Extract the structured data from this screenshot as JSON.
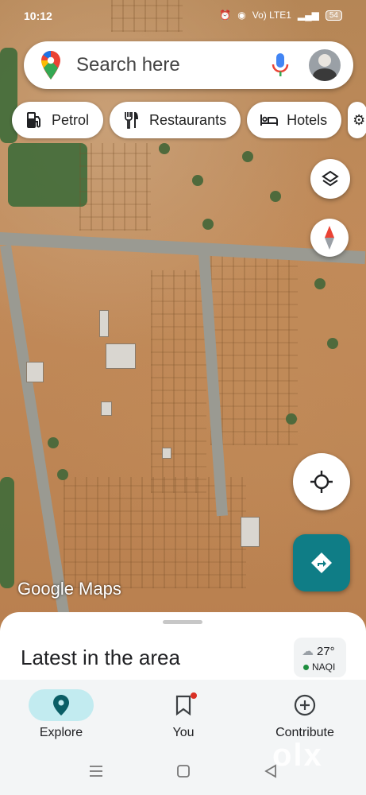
{
  "status_bar": {
    "time": "10:12",
    "net": "Vo) LTE1",
    "battery": "54"
  },
  "search": {
    "placeholder": "Search here"
  },
  "chips": [
    {
      "label": "Petrol",
      "icon": "gas-station-icon"
    },
    {
      "label": "Restaurants",
      "icon": "cutlery-icon"
    },
    {
      "label": "Hotels",
      "icon": "bed-icon"
    }
  ],
  "map": {
    "watermark": "Google Maps"
  },
  "sheet": {
    "title": "Latest in the area",
    "weather": {
      "temp": "27°",
      "aqi": "NAQI"
    }
  },
  "nav": {
    "items": [
      {
        "label": "Explore",
        "icon": "location-pin-icon",
        "active": true
      },
      {
        "label": "You",
        "icon": "bookmark-icon",
        "active": false
      },
      {
        "label": "Contribute",
        "icon": "add-circle-icon",
        "active": false
      }
    ]
  },
  "overlay": {
    "olx": "olx"
  },
  "colors": {
    "accent": "#0f7d86",
    "active_pill": "#c2ebf0",
    "notification": "#d93025"
  }
}
